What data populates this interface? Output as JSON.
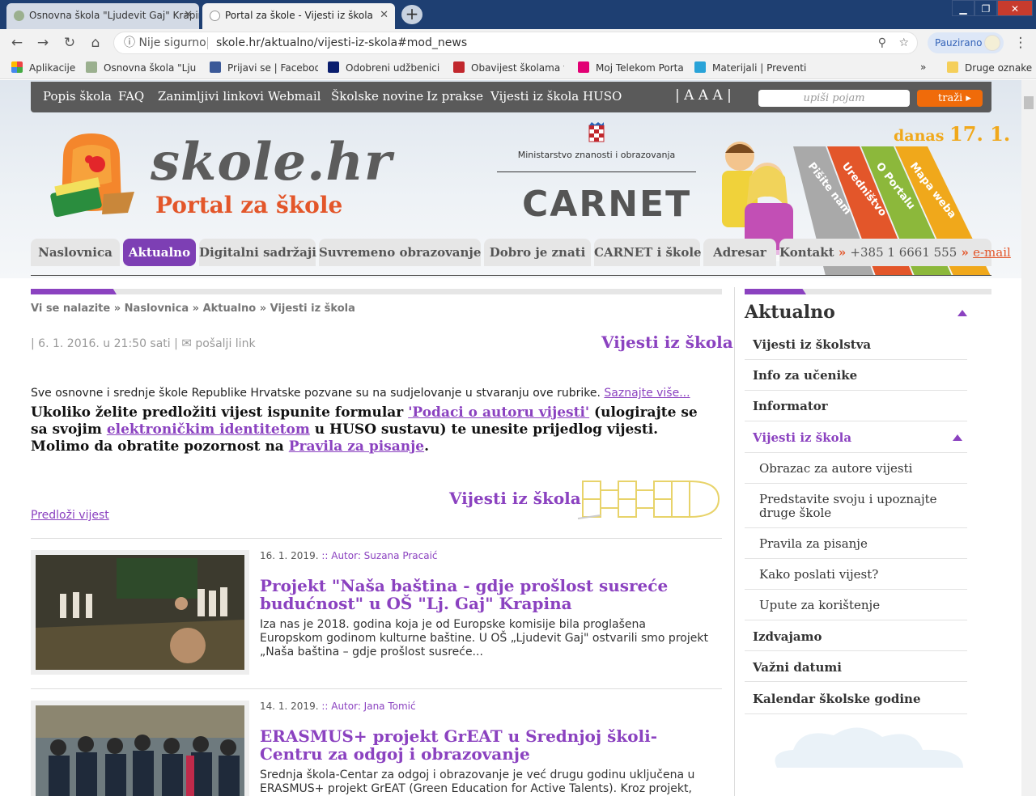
{
  "browser": {
    "tabs": [
      {
        "title": "Osnovna škola \"Ljudevit Gaj\" Krapina"
      },
      {
        "title": "Portal za škole - Vijesti iz škola"
      }
    ],
    "secure_label": "Nije sigurno",
    "url": "skole.hr/aktualno/vijesti-iz-skola#mod_news",
    "profile_label": "Pauzirano",
    "bookmarks": [
      {
        "label": "Aplikacije",
        "icon": "apps-grid-icon"
      },
      {
        "label": "Osnovna škola \"Ljude",
        "icon": "shield-favicon"
      },
      {
        "label": "Prijavi se | Facebook",
        "icon": "facebook-favicon"
      },
      {
        "label": "Odobreni udžbenici z",
        "icon": "oup-favicon"
      },
      {
        "label": "Obavijest školama ve",
        "icon": "hr-favicon"
      },
      {
        "label": "Moj Telekom Portal",
        "icon": "telekom-favicon"
      },
      {
        "label": "Materijali | Preventivn",
        "icon": "p-favicon"
      }
    ],
    "bookmarks_overflow": "»",
    "other_bookmarks": "Druge oznake"
  },
  "topnav": {
    "items": [
      "Popis škola",
      "FAQ",
      "Zanimljivi linkovi",
      "Webmail",
      "Školske novine",
      "Iz prakse",
      "Vijesti iz škola",
      "HUSO"
    ],
    "font_sizes": "| A A A |",
    "search_placeholder": "upiši pojam",
    "search_button": "traži"
  },
  "header": {
    "logo": "skole.hr",
    "logo_sub": "Portal za škole",
    "ministry": "Ministarstvo znanosti i obrazovanja",
    "carnet": "CARNET",
    "date_prefix": "danas",
    "date": "17. 1.",
    "ribbons": [
      "Pišite nam",
      "Uredništvo",
      "O Portalu",
      "Mapa weba"
    ]
  },
  "mainnav": {
    "items": [
      "Naslovnica",
      "Aktualno",
      "Digitalni sadržaji",
      "Suvremeno obrazovanje",
      "Dobro je znati",
      "CARNET i škole",
      "Adresar"
    ],
    "contact_label": "Kontakt",
    "phone": "+385 1 6661 555",
    "email": "e-mail"
  },
  "content": {
    "breadcrumb": [
      "Vi se nalazite",
      "Naslovnica",
      "Aktualno",
      "Vijesti iz škola"
    ],
    "meta_date": "| 6. 1. 2016. u 21:50 sati |",
    "send_link": "pošalji link",
    "section_title": "Vijesti iz škola",
    "intro": "Sve osnovne i srednje škole Republike Hrvatske pozvane su na sudjelovanje u stvaranju ove rubrike.",
    "intro_link": "Saznajte više...",
    "instr_1": "Ukoliko želite predložiti vijest ispunite formular ",
    "instr_link1": "'Podaci o autoru vijesti'",
    "instr_2": " (ulogirajte se sa svojim ",
    "instr_link2": "elektroničkim identitetom",
    "instr_3": " u HUSO sustavu) te unesite prijedlog vijesti. Molimo da obratite pozornost na ",
    "instr_link3": "Pravila za pisanje",
    "instr_4": ".",
    "section_title2": "Vijesti iz škola",
    "submit_link": "Predloži vijest",
    "articles": [
      {
        "date": "16. 1. 2019.",
        "author": ":: Autor: Suzana Pracaić",
        "title": "Projekt \"Naša baština - gdje prošlost susreće budućnost\" u OŠ \"Lj. Gaj\" Krapina",
        "summary": "Iza nas je 2018. godina koja je od Europske komisije bila proglašena Europskom godinom kulturne baštine. U OŠ „Ljudevit Gaj\" ostvarili smo projekt „Naša baština – gdje prošlost susreće..."
      },
      {
        "date": "14. 1. 2019.",
        "author": ":: Autor: Jana Tomić",
        "title": "ERASMUS+ projekt GrEAT u Srednjoj školi-Centru za odgoj i obrazovanje",
        "summary": "Srednja škola-Centar za odgoj i obrazovanje je već drugu godinu uključena u ERASMUS+ projekt GrEAT (Green Education for Active Talents). Kroz projekt, naši"
      }
    ]
  },
  "sidebar": {
    "title": "Aktualno",
    "items": [
      {
        "label": "Vijesti iz školstva",
        "level": "main"
      },
      {
        "label": "Info za učenike",
        "level": "main"
      },
      {
        "label": "Informator",
        "level": "main"
      },
      {
        "label": "Vijesti iz škola",
        "level": "main",
        "current": true
      },
      {
        "label": "Obrazac za autore vijesti",
        "level": "sub"
      },
      {
        "label": "Predstavite svoju i upoznajte druge škole",
        "level": "sub"
      },
      {
        "label": "Pravila za pisanje",
        "level": "sub"
      },
      {
        "label": "Kako poslati vijest?",
        "level": "sub"
      },
      {
        "label": "Upute za korištenje",
        "level": "sub"
      },
      {
        "label": "Izdvajamo",
        "level": "main"
      },
      {
        "label": "Važni datumi",
        "level": "main"
      },
      {
        "label": "Kalendar školske godine",
        "level": "main"
      }
    ]
  },
  "colors": {
    "accent": "#8b42c0",
    "orange": "#e3562a",
    "topnav": "#5a5a5a"
  }
}
